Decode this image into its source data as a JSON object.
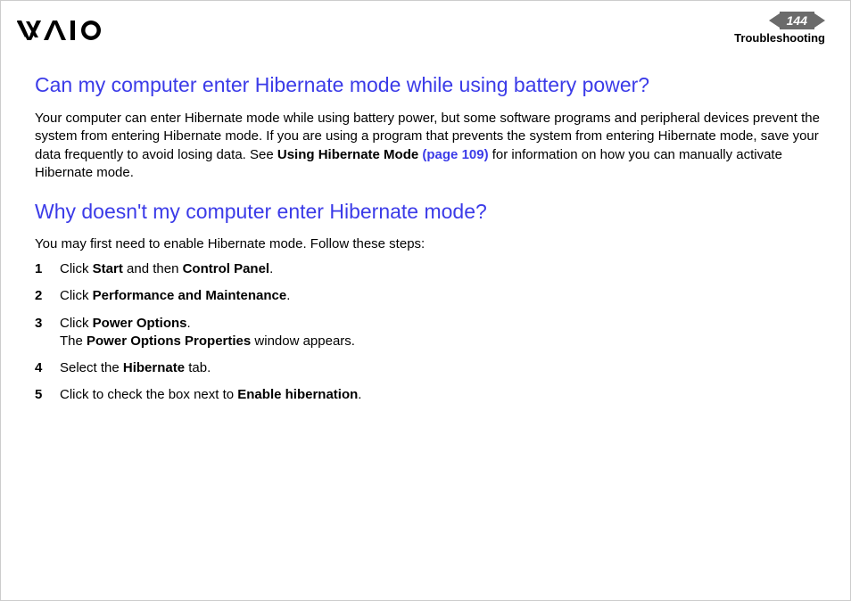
{
  "header": {
    "page_number": "144",
    "section": "Troubleshooting"
  },
  "section1": {
    "heading": "Can my computer enter Hibernate mode while using battery power?",
    "para_pre": "Your computer can enter Hibernate mode while using battery power, but some software programs and peripheral devices prevent the system from entering Hibernate mode. If you are using a program that prevents the system from entering Hibernate mode, save your data frequently to avoid losing data. See ",
    "para_bold": "Using Hibernate Mode ",
    "para_link": "(page 109)",
    "para_post": " for information on how you can manually activate Hibernate mode."
  },
  "section2": {
    "heading": "Why doesn't my computer enter Hibernate mode?",
    "intro": "You may first need to enable Hibernate mode. Follow these steps:",
    "steps": {
      "s1a": "Click ",
      "s1b": "Start",
      "s1c": " and then ",
      "s1d": "Control Panel",
      "s1e": ".",
      "s2a": "Click ",
      "s2b": "Performance and Maintenance",
      "s2c": ".",
      "s3a": "Click ",
      "s3b": "Power Options",
      "s3c": ".",
      "s3d": "The ",
      "s3e": "Power Options Properties",
      "s3f": " window appears.",
      "s4a": "Select the ",
      "s4b": "Hibernate",
      "s4c": " tab.",
      "s5a": "Click to check the box next to ",
      "s5b": "Enable hibernation",
      "s5c": "."
    }
  }
}
